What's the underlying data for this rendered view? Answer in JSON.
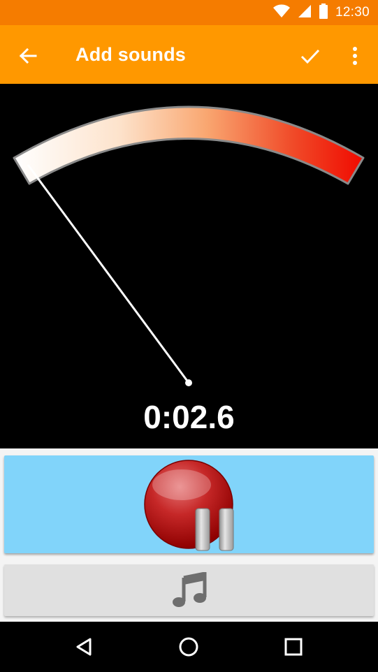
{
  "status_bar": {
    "time": "12:30",
    "icons": [
      "wifi-icon",
      "signal-icon",
      "battery-icon"
    ],
    "background": "#f57c00"
  },
  "app_bar": {
    "title": "Add sounds",
    "background": "#ff9800",
    "icons": [
      "back-arrow-icon",
      "check-icon",
      "more-vert-icon"
    ]
  },
  "meter": {
    "gradient_colors": [
      "#ffffff",
      "#fbc99a",
      "#f08050",
      "#f01000"
    ],
    "needle_level": 0
  },
  "timer": {
    "value": "0:02.6"
  },
  "record_button": {
    "icon": "record-pause-icon",
    "background": "#81d4fa"
  },
  "music_button": {
    "icon": "music-note-icon",
    "background": "#e0e0e0"
  },
  "nav_bar": {
    "icons": [
      "back-triangle-icon",
      "home-circle-icon",
      "recents-square-icon"
    ]
  }
}
